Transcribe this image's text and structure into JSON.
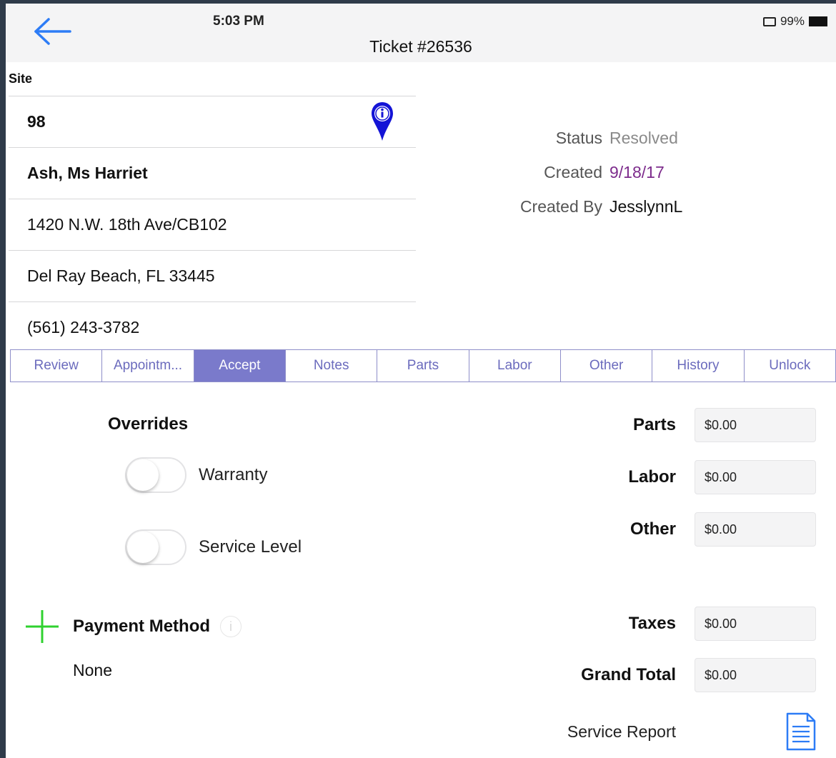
{
  "status_bar": {
    "time": "5:03 PM",
    "battery": "99%"
  },
  "header": {
    "title": "Ticket #26536"
  },
  "site": {
    "label": "Site",
    "number": "98",
    "name": "Ash, Ms Harriet",
    "address": "1420 N.W. 18th Ave/CB102",
    "city": "Del Ray Beach, FL 33445",
    "phone": "(561) 243-3782"
  },
  "meta": {
    "status_label": "Status",
    "status_value": "Resolved",
    "created_label": "Created",
    "created_value": "9/18/17",
    "created_by_label": "Created By",
    "created_by_value": "JesslynnL"
  },
  "tabs": [
    {
      "label": "Review"
    },
    {
      "label": "Appointm..."
    },
    {
      "label": "Accept",
      "active": true
    },
    {
      "label": "Notes"
    },
    {
      "label": "Parts"
    },
    {
      "label": "Labor"
    },
    {
      "label": "Other"
    },
    {
      "label": "History"
    },
    {
      "label": "Unlock"
    }
  ],
  "overrides": {
    "title": "Overrides",
    "warranty": "Warranty",
    "service_level": "Service Level"
  },
  "payment": {
    "title": "Payment Method",
    "info": "i",
    "value": "None"
  },
  "totals": {
    "parts_label": "Parts",
    "parts_value": "$0.00",
    "labor_label": "Labor",
    "labor_value": "$0.00",
    "other_label": "Other",
    "other_value": "$0.00",
    "taxes_label": "Taxes",
    "taxes_value": "$0.00",
    "grand_label": "Grand Total",
    "grand_value": "$0.00"
  },
  "service_report": {
    "label": "Service Report"
  },
  "colors": {
    "accent_blue": "#2d7cf6",
    "tab_active": "#7a7acb",
    "pin_blue": "#1414d6",
    "plus_green": "#2fd12f",
    "created_purple": "#7d2c8c"
  }
}
